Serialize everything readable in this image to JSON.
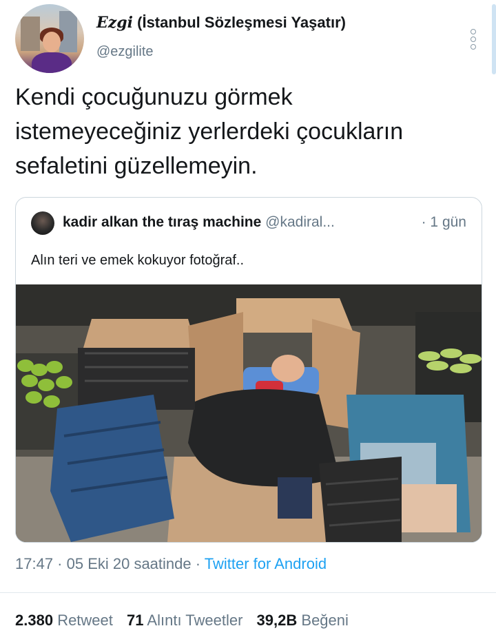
{
  "author": {
    "name_fancy": "Ezgi",
    "name_rest": " (İstanbul Sözleşmesi Yaşatır)",
    "handle": "@ezgilite"
  },
  "tweet": {
    "text": "Kendi çocuğunuzu görmek\nistemeyeceğiniz yerlerdeki çocukların\nsefaletini güzellemeyin."
  },
  "quoted": {
    "name": "kadir alkan the tıraş machine",
    "handle": "@kadiral...",
    "time": "· 1 gün",
    "text": "Alın teri ve emek kokuyor fotoğraf.."
  },
  "meta": {
    "time_date": "17:47 · 05 Eki 20 saatinde · ",
    "source": "Twitter for Android"
  },
  "stats": {
    "retweet_count": "2.380",
    "retweet_label": "Retweet",
    "quote_count": "71",
    "quote_label": "Alıntı Tweetler",
    "like_count": "39,2B",
    "like_label": "Beğeni"
  },
  "icons": {
    "more": "more-vertical-icon"
  },
  "colors": {
    "link": "#1da1f2",
    "secondary_text": "#657786",
    "border": "#ccd6dd"
  }
}
